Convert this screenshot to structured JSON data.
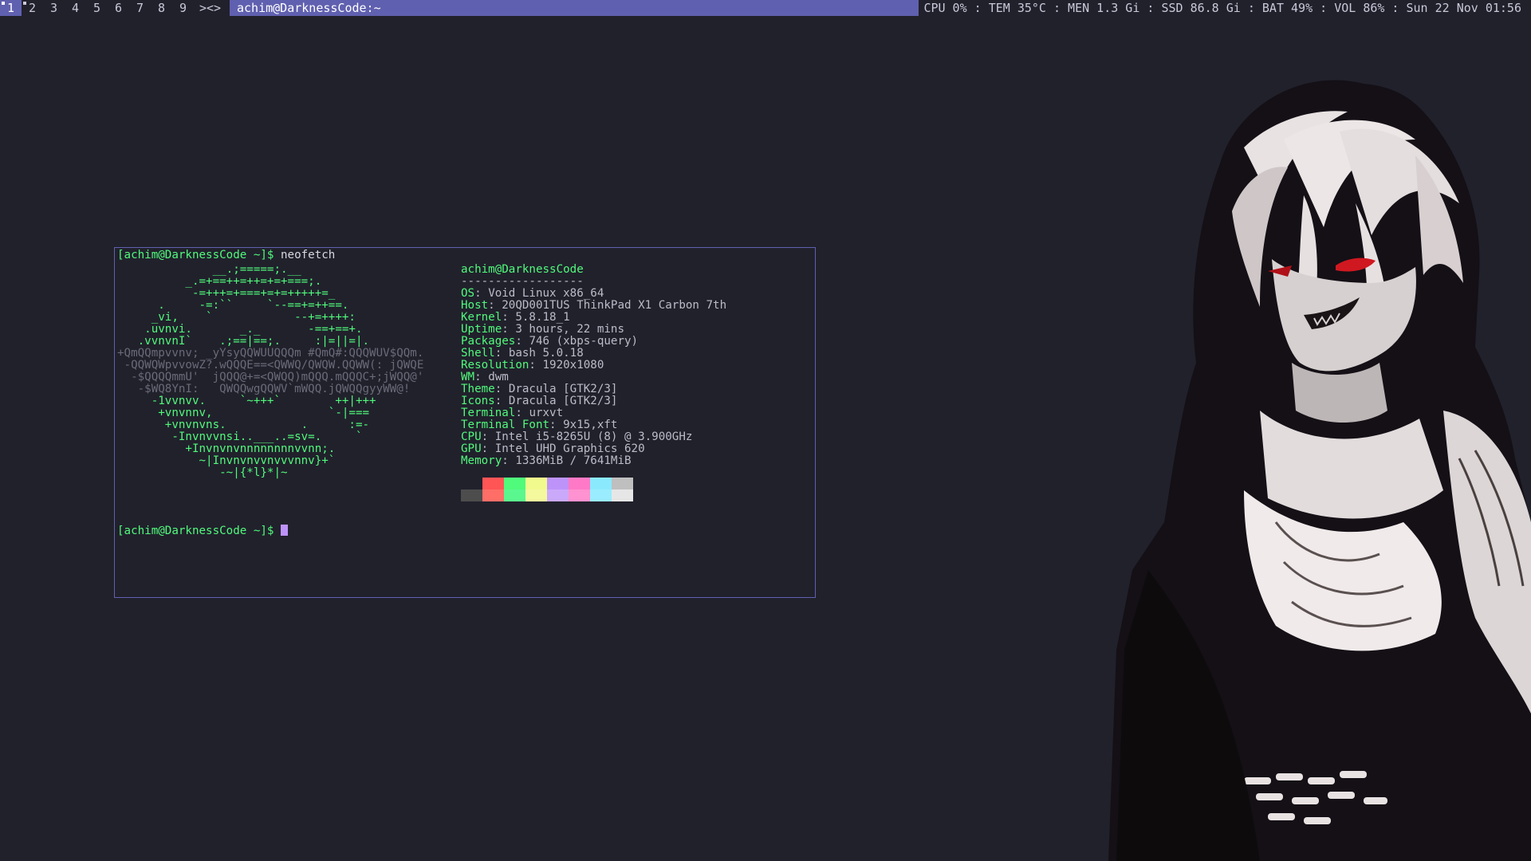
{
  "bar": {
    "tags": [
      {
        "label": "1",
        "active": true,
        "occupied": true
      },
      {
        "label": "2",
        "active": false,
        "occupied": true
      },
      {
        "label": "3",
        "active": false,
        "occupied": false
      },
      {
        "label": "4",
        "active": false,
        "occupied": false
      },
      {
        "label": "5",
        "active": false,
        "occupied": false
      },
      {
        "label": "6",
        "active": false,
        "occupied": false
      },
      {
        "label": "7",
        "active": false,
        "occupied": false
      },
      {
        "label": "8",
        "active": false,
        "occupied": false
      },
      {
        "label": "9",
        "active": false,
        "occupied": false
      }
    ],
    "layout_symbol": "><>",
    "window_title": "achim@DarknessCode:~",
    "status": "CPU 0% : TEM 35°C : MEN 1.3 Gi : SSD 86.8 Gi : BAT 49% : VOL 86% : Sun 22 Nov 01:56"
  },
  "terminal": {
    "prompt": "[achim@DarknessCode ~]$",
    "command": "neofetch",
    "logo_lines": [
      "              __.;=====;.__",
      "          _.=+==++=++=+=+===;.",
      "           -=+++=+===+=+=+++++=_",
      "      .     -=:``     `--==+=++==.",
      "     _vi,    `            --+=++++:",
      "    .uvnvi.       _._       -==+==+.",
      "   .vvnvnI`    .;==|==;.     :|=||=|.",
      "+QmQQmpvvnv; _yYsyQQWUUQQQm #QmQ#:QQQWUV$QQm.",
      " -QQWQWpvvowZ?.wQQQE==<QWWQ/QWQW.QQWW(: jQWQE",
      "  -$QQQQmmU'  jQQQ@+=<QWQQ)mQQQ.mQQQC+;jWQQ@'",
      "   -$WQ8YnI:   QWQQwgQQWV`mWQQ.jQWQQgyyWW@!",
      "     -1vvnvv.     `~+++`        ++|+++",
      "      +vnvnnv,                 `-|===",
      "       +vnvnvns.           .      :=-",
      "        -Invnvvnsi..___..=sv=.     `",
      "          +Invnvnvnnnnnnnnvvnn;.",
      "            ~|Invnvnvvnvvvnnv}+`",
      "               -~|{*l}*|~"
    ],
    "user_host": "achim@DarknessCode",
    "separator": "------------------",
    "info": [
      {
        "key": "OS",
        "value": "Void Linux x86_64"
      },
      {
        "key": "Host",
        "value": "20QD001TUS ThinkPad X1 Carbon 7th"
      },
      {
        "key": "Kernel",
        "value": "5.8.18_1"
      },
      {
        "key": "Uptime",
        "value": "3 hours, 22 mins"
      },
      {
        "key": "Packages",
        "value": "746 (xbps-query)"
      },
      {
        "key": "Shell",
        "value": "bash 5.0.18"
      },
      {
        "key": "Resolution",
        "value": "1920x1080"
      },
      {
        "key": "WM",
        "value": "dwm"
      },
      {
        "key": "Theme",
        "value": "Dracula [GTK2/3]"
      },
      {
        "key": "Icons",
        "value": "Dracula [GTK2/3]"
      },
      {
        "key": "Terminal",
        "value": "urxvt"
      },
      {
        "key": "Terminal Font",
        "value": "9x15,xft"
      },
      {
        "key": "CPU",
        "value": "Intel i5-8265U (8) @ 3.900GHz"
      },
      {
        "key": "GPU",
        "value": "Intel UHD Graphics 620"
      },
      {
        "key": "Memory",
        "value": "1336MiB / 7641MiB"
      }
    ],
    "palette_top": [
      "#21212c",
      "#ff5555",
      "#50fa7b",
      "#f1fa8c",
      "#bd93f9",
      "#ff79c6",
      "#8be9fd",
      "#bfbfbf"
    ],
    "palette_bottom": [
      "#4d4d4d",
      "#ff6e67",
      "#5af78e",
      "#f4f99d",
      "#caa9fa",
      "#ff92d0",
      "#9aedfe",
      "#e6e6e6"
    ],
    "second_prompt": "[achim@DarknessCode ~]$"
  },
  "colors": {
    "background": "#21212c",
    "accent": "#6060b0",
    "green": "#50fa7b",
    "cursor": "#bd93f9"
  }
}
